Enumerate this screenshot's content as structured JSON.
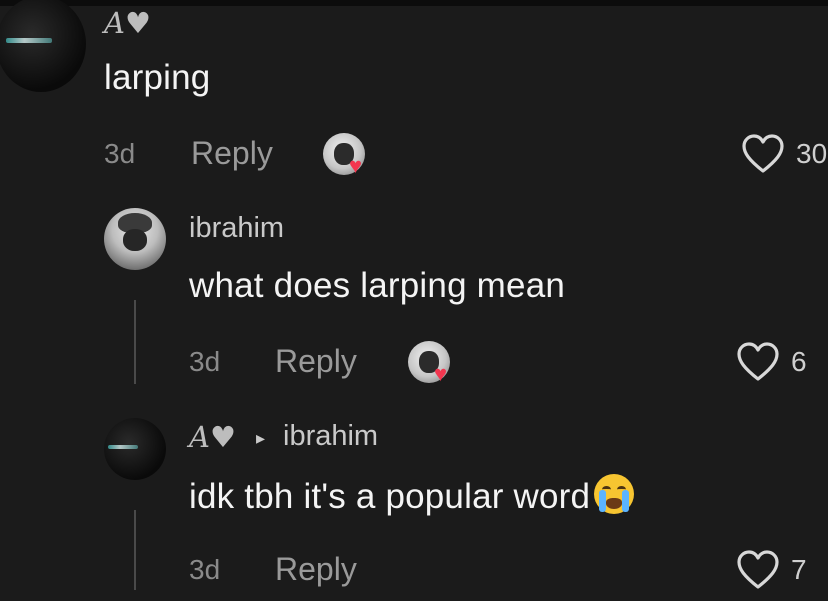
{
  "comments": [
    {
      "author": "A♥",
      "text": "larping",
      "time": "3d",
      "reply_label": "Reply",
      "likes": "30",
      "creator_liked": true
    },
    {
      "author": "ibrahim",
      "text": "what does larping mean",
      "time": "3d",
      "reply_label": "Reply",
      "likes": "6",
      "creator_liked": true
    },
    {
      "author": "A♥",
      "reply_to_arrow": "▸",
      "reply_to": "ibrahim",
      "text": "idk tbh it's a popular word",
      "emoji": "loudly-crying-face",
      "time": "3d",
      "reply_label": "Reply",
      "likes": "7",
      "creator_liked": false
    }
  ],
  "colors": {
    "background": "#1b1b1b",
    "creator_heart": "#f2364f",
    "muted_text": "#8a8a8a"
  }
}
